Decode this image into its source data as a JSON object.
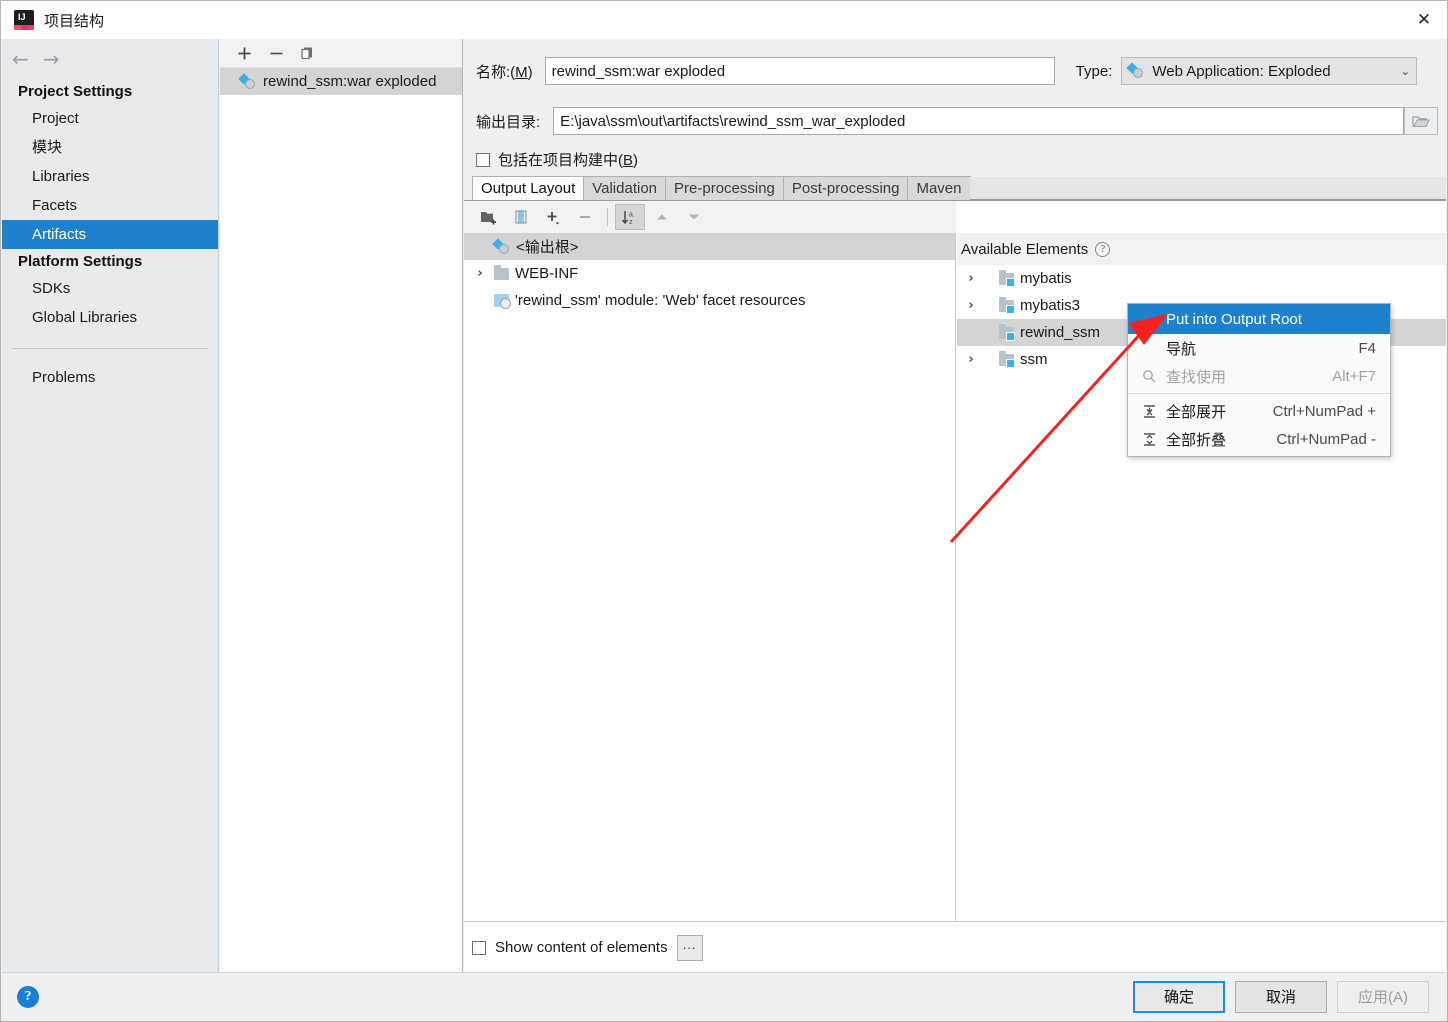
{
  "window": {
    "title": "项目结构",
    "app_icon": "intellij-idea-logo",
    "close_label": "✕"
  },
  "sidebar": {
    "back_icon": "←",
    "forward_icon": "→",
    "groups": [
      {
        "title": "Project Settings",
        "items": [
          {
            "label": "Project",
            "selected": false
          },
          {
            "label": "模块",
            "selected": false
          },
          {
            "label": "Libraries",
            "selected": false
          },
          {
            "label": "Facets",
            "selected": false
          },
          {
            "label": "Artifacts",
            "selected": true
          }
        ]
      },
      {
        "title": "Platform Settings",
        "items": [
          {
            "label": "SDKs",
            "selected": false
          },
          {
            "label": "Global Libraries",
            "selected": false
          }
        ]
      }
    ],
    "problems_label": "Problems",
    "selected_color": "#1e81ce"
  },
  "artifacts_panel": {
    "toolbar": [
      {
        "name": "add-artifact-button",
        "glyph": "+"
      },
      {
        "name": "remove-artifact-button",
        "glyph": "–"
      },
      {
        "name": "copy-artifact-button",
        "glyph": "copy-icon"
      }
    ],
    "items": [
      {
        "label": "rewind_ssm:war exploded",
        "selected": true,
        "icon": "artifact-icon"
      }
    ]
  },
  "detail": {
    "name_label": "名称:(M)",
    "name_label_plain": "名称:(",
    "name_mnemonic": "M",
    "name_value": "rewind_ssm:war exploded",
    "type_label": "Type:",
    "type_value": "Web Application: Exploded",
    "type_caret": "⌄",
    "output_dir_label": "输出目录:",
    "output_dir_value": "E:\\java\\ssm\\out\\artifacts\\rewind_ssm_war_exploded",
    "browse_icon": "folder-open-icon",
    "include_label_plain": "包括在项目构建中(",
    "include_mnemonic": "B",
    "include_label_tail": ")",
    "include_checked": false,
    "tabs": [
      {
        "label": "Output Layout",
        "active": true
      },
      {
        "label": "Validation",
        "active": false
      },
      {
        "label": "Pre-processing",
        "active": false
      },
      {
        "label": "Post-processing",
        "active": false
      },
      {
        "label": "Maven",
        "active": false
      }
    ]
  },
  "output_layout": {
    "toolbar": [
      {
        "name": "create-directory-button",
        "glyph": "new-folder-icon",
        "active": false
      },
      {
        "name": "create-archive-button",
        "glyph": "archive-icon",
        "active": false
      },
      {
        "name": "add-copy-of-button",
        "glyph": "+",
        "active": false
      },
      {
        "name": "remove-element-button",
        "glyph": "–",
        "active": false
      },
      {
        "name": "sort-elements-button",
        "glyph": "sort-az-icon",
        "active": true
      },
      {
        "name": "move-up-button",
        "glyph": "▲",
        "active": false
      },
      {
        "name": "move-down-button",
        "glyph": "▼",
        "active": false
      }
    ],
    "tree": [
      {
        "label": "<输出根>",
        "icon": "artifact-icon",
        "indent": 0,
        "twisty": "",
        "selected": true
      },
      {
        "label": "WEB-INF",
        "icon": "folder-icon",
        "indent": 0,
        "twisty": "›",
        "selected": false
      },
      {
        "label": "'rewind_ssm' module: 'Web' facet resources",
        "icon": "resources-icon",
        "indent": 0,
        "twisty": "",
        "selected": false
      }
    ]
  },
  "available_elements": {
    "title": "Available Elements",
    "help_icon": "question-mark-icon",
    "tree": [
      {
        "label": "mybatis",
        "twisty": "›",
        "selected": false
      },
      {
        "label": "mybatis3",
        "twisty": "›",
        "selected": false
      },
      {
        "label": "rewind_ssm",
        "twisty": "",
        "selected": true
      },
      {
        "label": "ssm",
        "twisty": "›",
        "selected": false
      }
    ]
  },
  "context_menu": {
    "items": [
      {
        "label": "Put into Output Root",
        "shortcut": "",
        "icon": "",
        "highlighted": true,
        "disabled": false
      },
      {
        "label": "导航",
        "shortcut": "F4",
        "icon": "",
        "highlighted": false,
        "disabled": false
      },
      {
        "label": "查找使用",
        "shortcut": "Alt+F7",
        "icon": "search-icon",
        "highlighted": false,
        "disabled": true
      },
      {
        "label": "全部展开",
        "shortcut": "Ctrl+NumPad +",
        "icon": "expand-all-icon",
        "highlighted": false,
        "disabled": false,
        "separator_before": true
      },
      {
        "label": "全部折叠",
        "shortcut": "Ctrl+NumPad -",
        "icon": "collapse-all-icon",
        "highlighted": false,
        "disabled": false
      }
    ],
    "highlight_color": "#1e81ce"
  },
  "bottom_panel": {
    "show_content_label": "Show content of elements",
    "show_content_checked": false,
    "more_button_label": "..."
  },
  "footer": {
    "help_label": "?",
    "ok_label": "确定",
    "cancel_label": "取消",
    "apply_label": "应用(A)",
    "apply_disabled": true
  },
  "annotation": {
    "arrow_color": "#f5231f",
    "description": "red arrow pointing to Put into Output Root"
  }
}
